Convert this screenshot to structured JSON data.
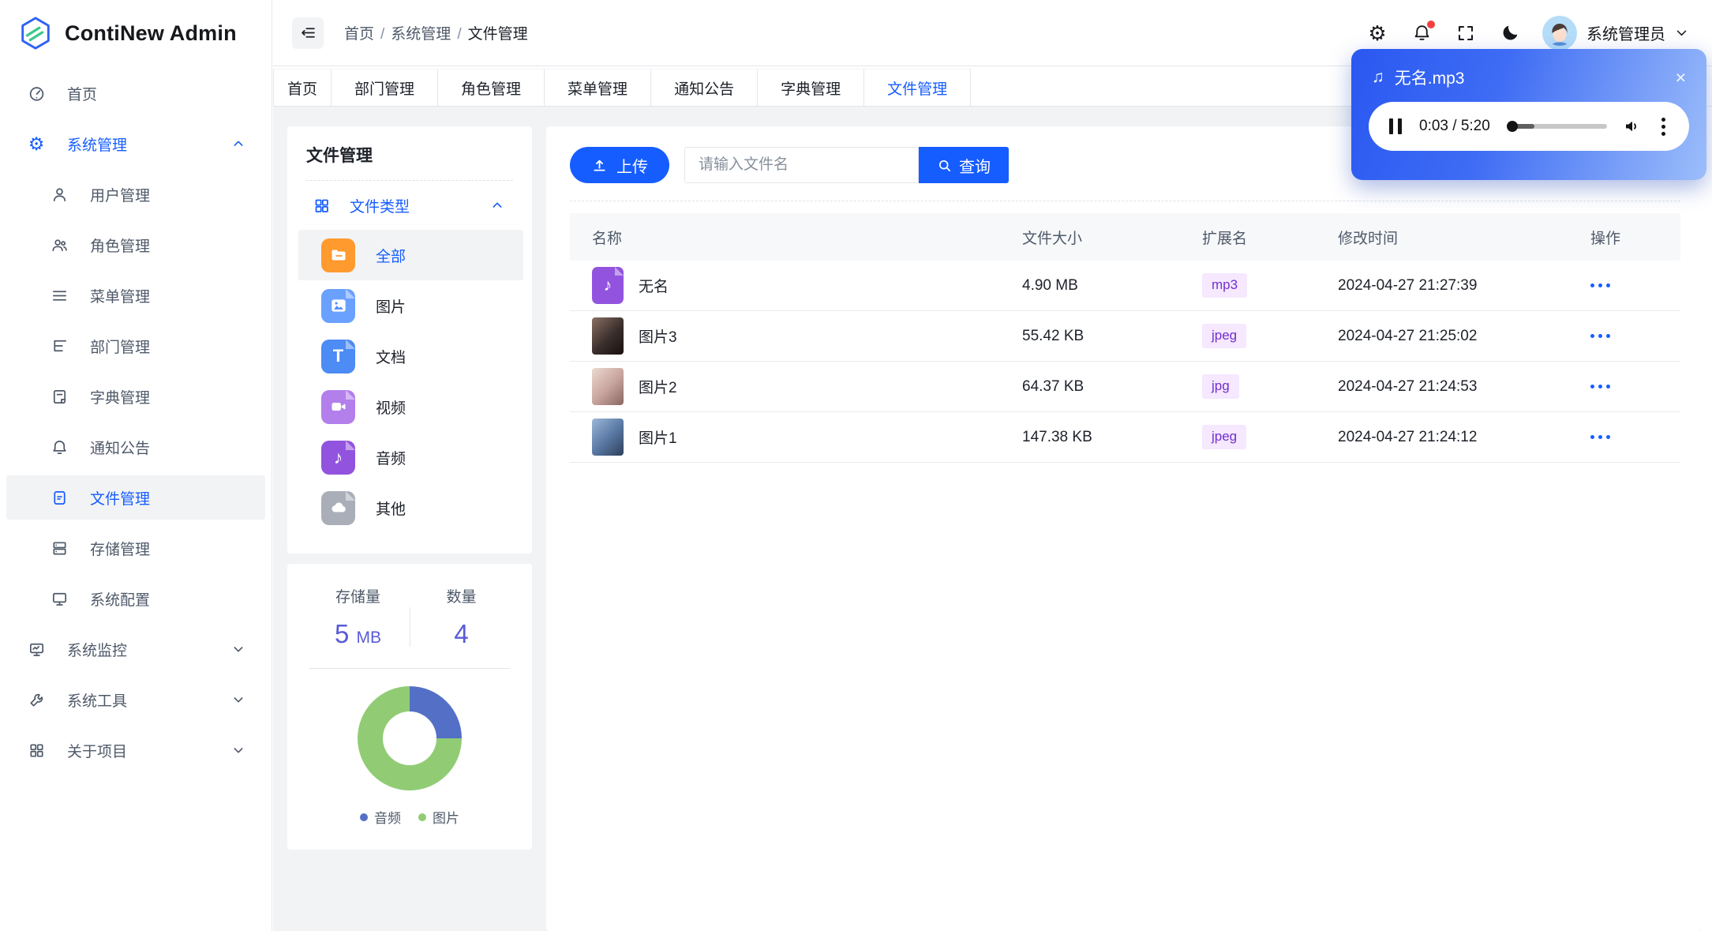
{
  "app": {
    "title": "ContiNew Admin",
    "user_name": "系统管理员"
  },
  "colors": {
    "primary": "#165DFF",
    "badge_bg": "#F5E8FF",
    "badge_text": "#722ED1",
    "stat_number": "#5A5BD6",
    "player_gradient_start": "#2A58F1",
    "player_gradient_end": "#9DBEFA"
  },
  "sidebar": {
    "items": [
      {
        "label": "首页",
        "icon": "dashboard-icon"
      },
      {
        "label": "系统管理",
        "icon": "gear-icon",
        "expanded": true
      },
      {
        "label": "用户管理",
        "icon": "user-icon"
      },
      {
        "label": "角色管理",
        "icon": "users-icon"
      },
      {
        "label": "菜单管理",
        "icon": "menu-lines-icon"
      },
      {
        "label": "部门管理",
        "icon": "tree-icon"
      },
      {
        "label": "字典管理",
        "icon": "dictionary-icon"
      },
      {
        "label": "通知公告",
        "icon": "bell-icon"
      },
      {
        "label": "文件管理",
        "icon": "file-icon",
        "active": true
      },
      {
        "label": "存储管理",
        "icon": "storage-icon"
      },
      {
        "label": "系统配置",
        "icon": "monitor-icon"
      },
      {
        "label": "系统监控",
        "icon": "monitor-chart-icon"
      },
      {
        "label": "系统工具",
        "icon": "wrench-icon"
      },
      {
        "label": "关于项目",
        "icon": "grid-icon"
      }
    ]
  },
  "breadcrumb": [
    "首页",
    "系统管理",
    "文件管理"
  ],
  "tabs": [
    "首页",
    "部门管理",
    "角色管理",
    "菜单管理",
    "通知公告",
    "字典管理",
    "文件管理"
  ],
  "filePanel": {
    "title": "文件管理",
    "group_label": "文件类型",
    "types": [
      {
        "label": "全部",
        "icon": "folder-icon",
        "active": true
      },
      {
        "label": "图片",
        "icon": "image-file-icon"
      },
      {
        "label": "文档",
        "icon": "document-file-icon"
      },
      {
        "label": "视频",
        "icon": "video-file-icon"
      },
      {
        "label": "音频",
        "icon": "audio-file-icon"
      },
      {
        "label": "其他",
        "icon": "other-file-icon"
      }
    ]
  },
  "stats": {
    "storage_label": "存储量",
    "storage_value": "5",
    "storage_unit": "MB",
    "count_label": "数量",
    "count_value": "4"
  },
  "chart_data": {
    "type": "pie",
    "donut": true,
    "categories": [
      "音频",
      "图片"
    ],
    "values": [
      1,
      3
    ],
    "colors": [
      "#5470C6",
      "#91CC75"
    ],
    "legend_position": "bottom"
  },
  "toolbar": {
    "upload_label": "上传",
    "search_placeholder": "请输入文件名",
    "search_label": "查询"
  },
  "table": {
    "columns": [
      "名称",
      "文件大小",
      "扩展名",
      "修改时间",
      "操作"
    ],
    "rows": [
      {
        "name": "无名",
        "size": "4.90 MB",
        "ext": "mp3",
        "time": "2024-04-27 21:27:39"
      },
      {
        "name": "图片3",
        "size": "55.42 KB",
        "ext": "jpeg",
        "time": "2024-04-27 21:25:02"
      },
      {
        "name": "图片2",
        "size": "64.37 KB",
        "ext": "jpg",
        "time": "2024-04-27 21:24:53"
      },
      {
        "name": "图片1",
        "size": "147.38 KB",
        "ext": "jpeg",
        "time": "2024-04-27 21:24:12"
      }
    ]
  },
  "player": {
    "title": "无名.mp3",
    "time": "0:03 / 5:20"
  }
}
